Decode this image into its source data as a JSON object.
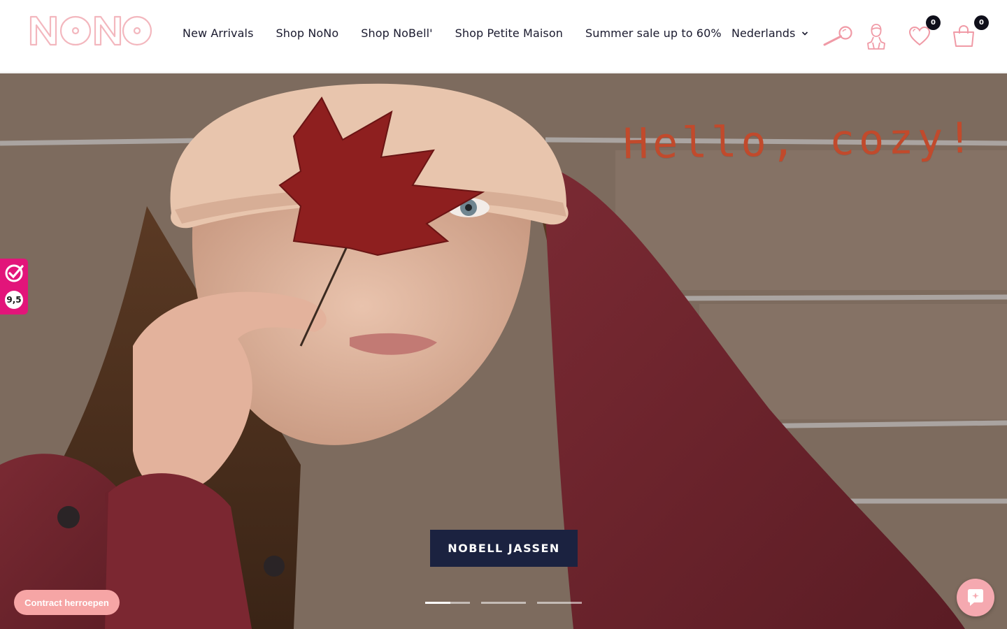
{
  "header": {
    "logo_text": "NONO",
    "nav": [
      {
        "label": "New Arrivals"
      },
      {
        "label": "Shop NoNo"
      },
      {
        "label": "Shop NoBell'"
      },
      {
        "label": "Shop Petite Maison"
      },
      {
        "label": "Summer sale up to 60%"
      }
    ],
    "language": "Nederlands",
    "icons": {
      "search": "search-icon",
      "account": "account-icon",
      "wishlist": "heart-icon",
      "cart": "shopping-bag-icon"
    },
    "wishlist_count": "0",
    "cart_count": "0",
    "accent_color": "#f09aa6"
  },
  "hero": {
    "headline": "Hello, cozy!",
    "cta_label": "NOBELL JASSEN",
    "slides_total": 3,
    "active_slide": 1
  },
  "widgets": {
    "trust_score": "9,5",
    "contract_label": "Contract herroepen",
    "chat": "chat-icon"
  },
  "colors": {
    "cta_bg": "#1b2240",
    "headline": "#c14a2c",
    "trust_badge": "#e2157a",
    "contract_btn": "#f6a5a5"
  }
}
